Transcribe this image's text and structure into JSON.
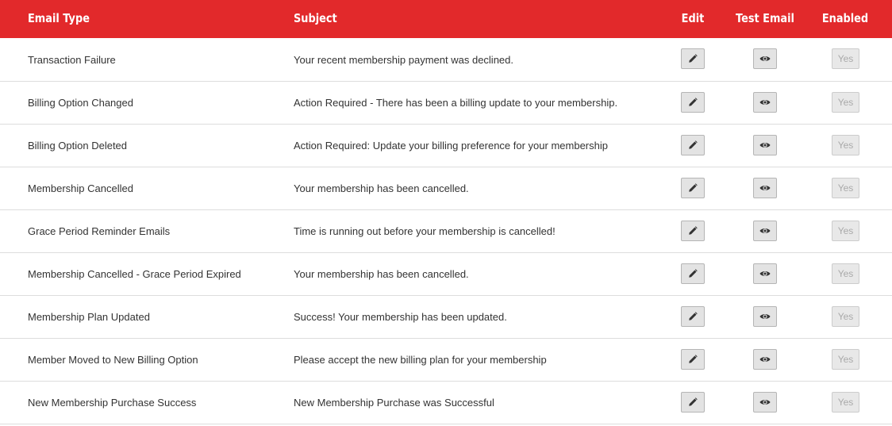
{
  "header": {
    "email_type": "Email Type",
    "subject": "Subject",
    "edit": "Edit",
    "test_email": "Test Email",
    "enabled": "Enabled"
  },
  "colors": {
    "header_bg": "#e2292b",
    "header_text": "#ffffff"
  },
  "icons": {
    "edit": "pencil-icon",
    "test_email": "eye-icon"
  },
  "rows": [
    {
      "email_type": "Transaction Failure",
      "subject": "Your recent membership payment was declined.",
      "enabled": "Yes"
    },
    {
      "email_type": "Billing Option Changed",
      "subject": "Action Required - There has been a billing update to your membership.",
      "enabled": "Yes"
    },
    {
      "email_type": "Billing Option Deleted",
      "subject": "Action Required: Update your billing preference for your membership",
      "enabled": "Yes"
    },
    {
      "email_type": "Membership Cancelled",
      "subject": "Your membership has been cancelled.",
      "enabled": "Yes"
    },
    {
      "email_type": "Grace Period Reminder Emails",
      "subject": "Time is running out before your membership is cancelled!",
      "enabled": "Yes"
    },
    {
      "email_type": "Membership Cancelled - Grace Period Expired",
      "subject": "Your membership has been cancelled.",
      "enabled": "Yes"
    },
    {
      "email_type": "Membership Plan Updated",
      "subject": "Success! Your membership has been updated.",
      "enabled": "Yes"
    },
    {
      "email_type": "Member Moved to New Billing Option",
      "subject": "Please accept the new billing plan for your membership",
      "enabled": "Yes"
    },
    {
      "email_type": "New Membership Purchase Success",
      "subject": "New Membership Purchase was Successful",
      "enabled": "Yes"
    }
  ]
}
